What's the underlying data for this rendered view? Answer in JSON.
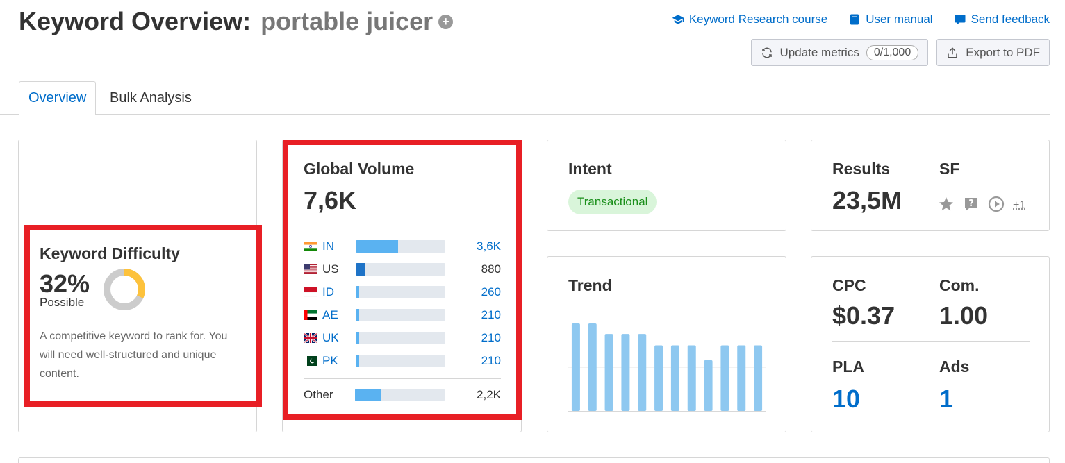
{
  "header": {
    "title_prefix": "Keyword Overview:",
    "keyword": "portable juicer",
    "add_icon": "plus-circle-icon",
    "links": [
      {
        "label": "Keyword Research course",
        "icon": "graduation-cap-icon"
      },
      {
        "label": "User manual",
        "icon": "book-icon"
      },
      {
        "label": "Send feedback",
        "icon": "chat-bubble-icon"
      }
    ],
    "update_metrics_label": "Update metrics",
    "update_metrics_counter": "0/1,000",
    "export_label": "Export to PDF"
  },
  "tabs": [
    {
      "label": "Overview",
      "active": true
    },
    {
      "label": "Bulk Analysis",
      "active": false
    }
  ],
  "keyword_difficulty": {
    "title": "Keyword Difficulty",
    "percent": "32%",
    "percent_value": 32,
    "level": "Possible",
    "description": "A competitive keyword to rank for. You will need well-structured and unique content.",
    "gauge_color": "#fdc23c",
    "gauge_track_color": "#cccccc"
  },
  "global_volume": {
    "title": "Global Volume",
    "total": "7,6K",
    "countries": [
      {
        "flag": "india-flag-icon",
        "code": "IN",
        "value": "3,6K",
        "share": 0.47,
        "linked": true,
        "highlight": false
      },
      {
        "flag": "usa-flag-icon",
        "code": "US",
        "value": "880",
        "share": 0.11,
        "linked": false,
        "highlight": true
      },
      {
        "flag": "indonesia-flag-icon",
        "code": "ID",
        "value": "260",
        "share": 0.034,
        "linked": true,
        "highlight": false
      },
      {
        "flag": "uae-flag-icon",
        "code": "AE",
        "value": "210",
        "share": 0.028,
        "linked": true,
        "highlight": false
      },
      {
        "flag": "uk-flag-icon",
        "code": "UK",
        "value": "210",
        "share": 0.028,
        "linked": true,
        "highlight": false
      },
      {
        "flag": "pakistan-flag-icon",
        "code": "PK",
        "value": "210",
        "share": 0.028,
        "linked": true,
        "highlight": false
      }
    ],
    "other": {
      "label": "Other",
      "value": "2,2K",
      "share": 0.29
    }
  },
  "intent": {
    "title": "Intent",
    "badge": "Transactional",
    "badge_color": "#d9f5da"
  },
  "results": {
    "title": "Results",
    "value": "23,5M",
    "sf_title": "SF",
    "sf_icons": [
      "star-icon",
      "question-icon",
      "play-circle-icon"
    ],
    "sf_more": "+1"
  },
  "trend": {
    "title": "Trend"
  },
  "chart_data": {
    "type": "bar",
    "title": "Trend",
    "values": [
      1.0,
      1.0,
      0.88,
      0.88,
      0.88,
      0.75,
      0.75,
      0.75,
      0.58,
      0.75,
      0.75,
      0.75
    ],
    "bar_color": "#8ec8f0"
  },
  "cpc": {
    "cpc_label": "CPC",
    "cpc_value": "$0.37",
    "com_label": "Com.",
    "com_value": "1.00",
    "pla_label": "PLA",
    "pla_value": "10",
    "ads_label": "Ads",
    "ads_value": "1"
  }
}
